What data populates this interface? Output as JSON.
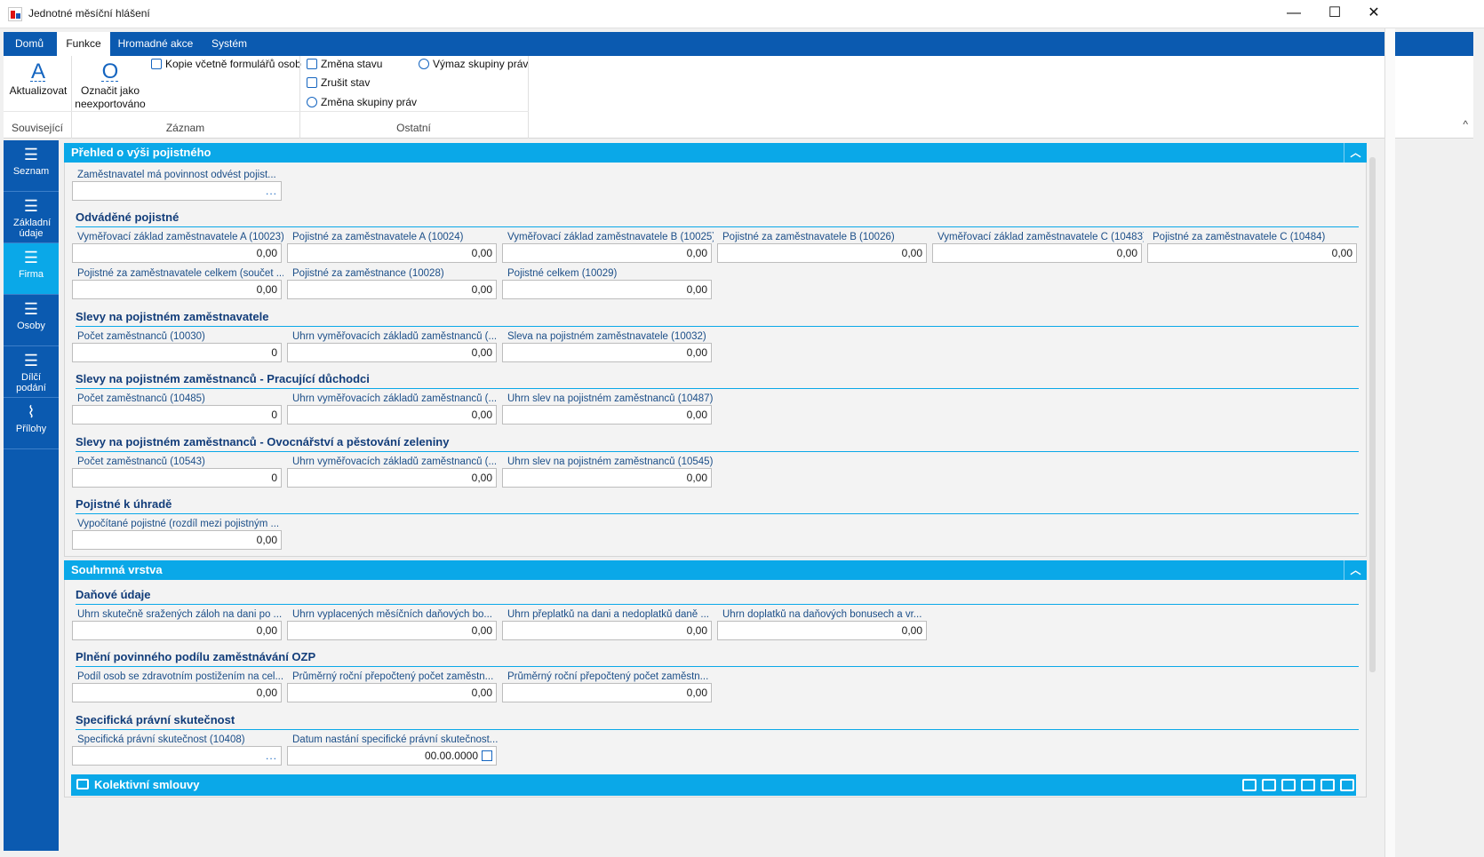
{
  "window": {
    "title": "Jednotné měsíční hlášení",
    "minimize": "—",
    "maximize": "☐",
    "close": "✕"
  },
  "ribbon": {
    "tabs": [
      "Domů",
      "Funkce",
      "Hromadné akce",
      "Systém"
    ],
    "actions": {
      "refresh": "Aktualizovat",
      "mark_unexported": "Označit jako neexportováno",
      "copy_with_forms": "Kopie včetně formulářů osob",
      "change_state": "Změna stavu",
      "cancel_state": "Zrušit stav",
      "change_rights_group": "Změna skupiny práv",
      "remove_rights_group": "Výmaz skupiny práv"
    },
    "groups": [
      "Související",
      "Záznam",
      "Ostatní"
    ],
    "collapse": "^"
  },
  "sidebar": [
    {
      "label": "Seznam"
    },
    {
      "label": "Základní údaje"
    },
    {
      "label": "Firma"
    },
    {
      "label": "Osoby"
    },
    {
      "label": "Dílčí podání"
    },
    {
      "label": "Přílohy"
    }
  ],
  "section1": {
    "title": "Přehled o výši pojistného",
    "employer_obligation": {
      "label": "Zaměstnavatel má povinnost odvést pojist...",
      "value": "..."
    },
    "odvadene": {
      "title": "Odváděné pojistné",
      "fields": [
        {
          "label": "Vyměřovací základ zaměstnavatele A (10023)",
          "value": "0,00"
        },
        {
          "label": "Pojistné za zaměstnavatele A (10024)",
          "value": "0,00"
        },
        {
          "label": "Vyměřovací základ zaměstnavatele B (10025)",
          "value": "0,00"
        },
        {
          "label": "Pojistné za zaměstnavatele B (10026)",
          "value": "0,00"
        },
        {
          "label": "Vyměřovací základ zaměstnavatele C (10483)",
          "value": "0,00"
        },
        {
          "label": "Pojistné za zaměstnavatele C (10484)",
          "value": "0,00"
        },
        {
          "label": "Pojistné za zaměstnavatele celkem (součet ...",
          "value": "0,00"
        },
        {
          "label": "Pojistné za zaměstnance (10028)",
          "value": "0,00"
        },
        {
          "label": "Pojistné celkem (10029)",
          "value": "0,00"
        }
      ]
    },
    "slevy_zamestnavatele": {
      "title": "Slevy na pojistném zaměstnavatele",
      "fields": [
        {
          "label": "Počet zaměstnanců (10030)",
          "value": "0"
        },
        {
          "label": "Úhrn vyměřovacích základů zaměstnanců (...",
          "value": "0,00"
        },
        {
          "label": "Sleva na pojistném zaměstnavatele (10032)",
          "value": "0,00"
        }
      ]
    },
    "slevy_duchodci": {
      "title": "Slevy na pojistném zaměstnanců - Pracující důchodci",
      "fields": [
        {
          "label": "Počet zaměstnanců (10485)",
          "value": "0"
        },
        {
          "label": "Úhrn vyměřovacích základů zaměstnanců (...",
          "value": "0,00"
        },
        {
          "label": "Úhrn slev na pojistném zaměstnanců (10487)",
          "value": "0,00"
        }
      ]
    },
    "slevy_ovocnarstvi": {
      "title": "Slevy na pojistném zaměstnanců - Ovocnářství a pěstování zeleniny",
      "fields": [
        {
          "label": "Počet zaměstnanců (10543)",
          "value": "0"
        },
        {
          "label": "Úhrn vyměřovacích základů zaměstnanců (...",
          "value": "0,00"
        },
        {
          "label": "Úhrn slev na pojistném zaměstnanců (10545)",
          "value": "0,00"
        }
      ]
    },
    "k_uhrade": {
      "title": "Pojistné k úhradě",
      "fields": [
        {
          "label": "Vypočítané pojistné (rozdíl mezi pojistným ...",
          "value": "0,00"
        }
      ]
    }
  },
  "section2": {
    "title": "Souhrnná vrstva",
    "danove": {
      "title": "Daňové údaje",
      "fields": [
        {
          "label": "Úhrn skutečně sražených záloh na dani po ...",
          "value": "0,00"
        },
        {
          "label": "Úhrn vyplacených měsíčních daňových bo...",
          "value": "0,00"
        },
        {
          "label": "Úhrn přeplatků na dani a nedoplatků daně ...",
          "value": "0,00"
        },
        {
          "label": "Úhrn doplatků na daňových bonusech a vr...",
          "value": "0,00"
        }
      ]
    },
    "ozp": {
      "title": "Plnění povinného podílu zaměstnávání OZP",
      "fields": [
        {
          "label": "Podíl osob se zdravotním postižením na cel...",
          "value": "0,00"
        },
        {
          "label": "Průměrný roční přepočtený počet zaměstn...",
          "value": "0,00"
        },
        {
          "label": "Průměrný roční přepočtený počet zaměstn...",
          "value": "0,00"
        }
      ]
    },
    "specificka": {
      "title": "Specifická právní skutečnost",
      "fields": [
        {
          "label": "Specifická právní skutečnost (10408)",
          "value": "..."
        },
        {
          "label": "Datum nastání specifické právní skutečnost...",
          "value": "00.00.0000"
        }
      ]
    }
  },
  "bottom_bar": {
    "title": "Kolektivní smlouvy"
  },
  "collapse_glyph": "︿"
}
